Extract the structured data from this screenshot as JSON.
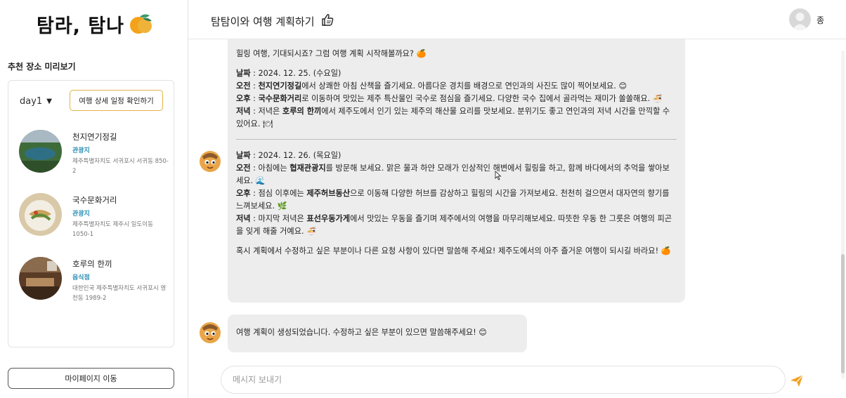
{
  "app": {
    "logo_text": "탐라, 탐나"
  },
  "sidebar": {
    "section_title": "추천 장소 미리보기",
    "day_label": "day1",
    "detail_button": "여행 상세 일정 확인하기",
    "places": [
      {
        "name": "천지연기정길",
        "type": "관광지",
        "address": "제주특별자치도 서귀포시 서귀동 850-2"
      },
      {
        "name": "국수문화거리",
        "type": "관광지",
        "address": "제주특별자치도 제주시 일도이동 1050-1"
      },
      {
        "name": "호루의 한끼",
        "type": "음식점",
        "address": "대한민국 제주특별자치도 서귀포시 영천동 1989-2"
      }
    ],
    "mypage_button": "마이페이지 이동"
  },
  "header": {
    "title": "탐탐이와 여행 계획하기",
    "title_icon": "thumbs-up-icon",
    "user_name": "종"
  },
  "chat": {
    "intro": "힐링 여행, 기대되시죠? 그럼 여행 계획 시작해볼까요? 🍊",
    "days": [
      {
        "date_label": "날짜",
        "date_value": " : 2024. 12. 25. (수요일)",
        "morning_label": "오전",
        "morning_place": "천지연기정길",
        "morning_text": "에서 상쾌한 아침 산책을 즐기세요. 아름다운 경치를 배경으로 연인과의 사진도 많이 찍어보세요. 😊",
        "afternoon_label": "오후",
        "afternoon_place": "국수문화거리",
        "afternoon_text": "로 이동하여 맛있는 제주 특산물인 국수로 점심을 즐기세요. 다양한 국수 집에서 골라먹는 재미가 쏠쏠해요. 🍜",
        "evening_label": "저녁",
        "evening_prefix": " : 저녁은 ",
        "evening_place": "호루의 한끼",
        "evening_text": "에서 제주도에서 인기 있는 제주의 해산물 요리를 맛보세요. 분위기도 좋고 연인과의 저녁 시간을 만끽할 수 있어요. 🍽"
      },
      {
        "date_label": "날짜",
        "date_value": " : 2024. 12. 26. (목요일)",
        "morning_label": "오전",
        "morning_prefix": " : 아침에는 ",
        "morning_place": "협재관광지",
        "morning_text": "를 방문해 보세요. 맑은 물과 하얀 모래가 인상적인 해변에서 힐링을 하고, 함께 바다에서의 추억을 쌓아보세요. 🌊",
        "afternoon_label": "오후",
        "afternoon_prefix": " : 점심 이후에는 ",
        "afternoon_place": "제주허브동산",
        "afternoon_text": "으로 이동해 다양한 허브를 감상하고 힐링의 시간을 가져보세요. 천천히 걸으면서 대자연의 향기를 느껴보세요. 🌿",
        "evening_label": "저녁",
        "evening_prefix": " : 마지막 저녁은 ",
        "evening_place": "표선우동가게",
        "evening_text": "에서 맛있는 우동을 즐기며 제주에서의 여행을 마무리해보세요. 따뜻한 우동 한 그릇은 여행의 피곤을 잊게 해줄 거예요. 🍜"
      }
    ],
    "outro": "혹시 계획에서 수정하고 싶은 부분이나 다른 요청 사항이 있다면 말씀해 주세요! 제주도에서의 아주 즐거운 여행이 되시길 바라요! 🍊",
    "generated_message": "여행 계획이 생성되었습니다. 수정하고 싶은 부분이 있으면 말씀해주세요! 😊",
    "input_placeholder": "메시지 보내기"
  },
  "colors": {
    "accent": "#e2b24a",
    "type_tag": "#2a8fb5",
    "send_icon": "#f0a021",
    "bubble": "#ededed"
  }
}
